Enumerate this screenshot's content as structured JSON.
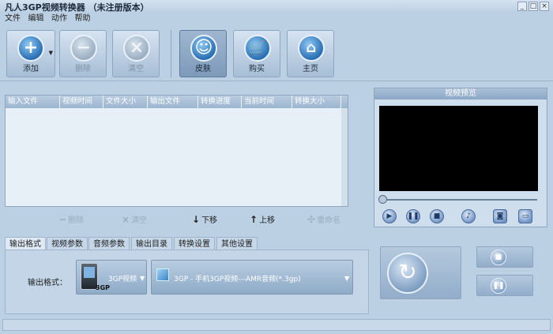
{
  "window": {
    "title": "凡人3GP视频转换器 （未注册版本）"
  },
  "menu": [
    "文件",
    "编辑",
    "动作",
    "帮助"
  ],
  "toolbar": {
    "add": "添加",
    "delete": "删除",
    "clear": "清空",
    "skin": "皮肤",
    "buy": "购买",
    "home": "主页"
  },
  "file_table": {
    "columns": [
      "输入文件",
      "视频时间",
      "文件大小",
      "输出文件",
      "转换进度",
      "当前时间",
      "转换大小"
    ]
  },
  "list_actions": {
    "delete": "删除",
    "clear": "清空",
    "move_down": "下移",
    "move_up": "上移",
    "rename": "重命名"
  },
  "preview": {
    "title": "视频预览"
  },
  "tabs": [
    "输出格式",
    "视频参数",
    "音频参数",
    "输出目录",
    "转换设置",
    "其他设置"
  ],
  "output": {
    "label": "输出格式：",
    "format_value": "3GP视频",
    "format_badge": "3GP",
    "profile_value": "3GP - 手机3GP视频---AMR音频(*.3gp)"
  },
  "icons": {
    "add": "plus-icon",
    "delete": "minus-icon",
    "clear": "x-icon",
    "skin": "smiley-icon",
    "buy": "cart-icon",
    "home": "house-icon",
    "convert": "convert-arrow-icon",
    "stop": "stop-icon",
    "pause": "pause-icon"
  },
  "colors": {
    "video_bg": "#000000",
    "toolbar_bg": "#bcd0e3",
    "accent": "#2a6fb4"
  }
}
